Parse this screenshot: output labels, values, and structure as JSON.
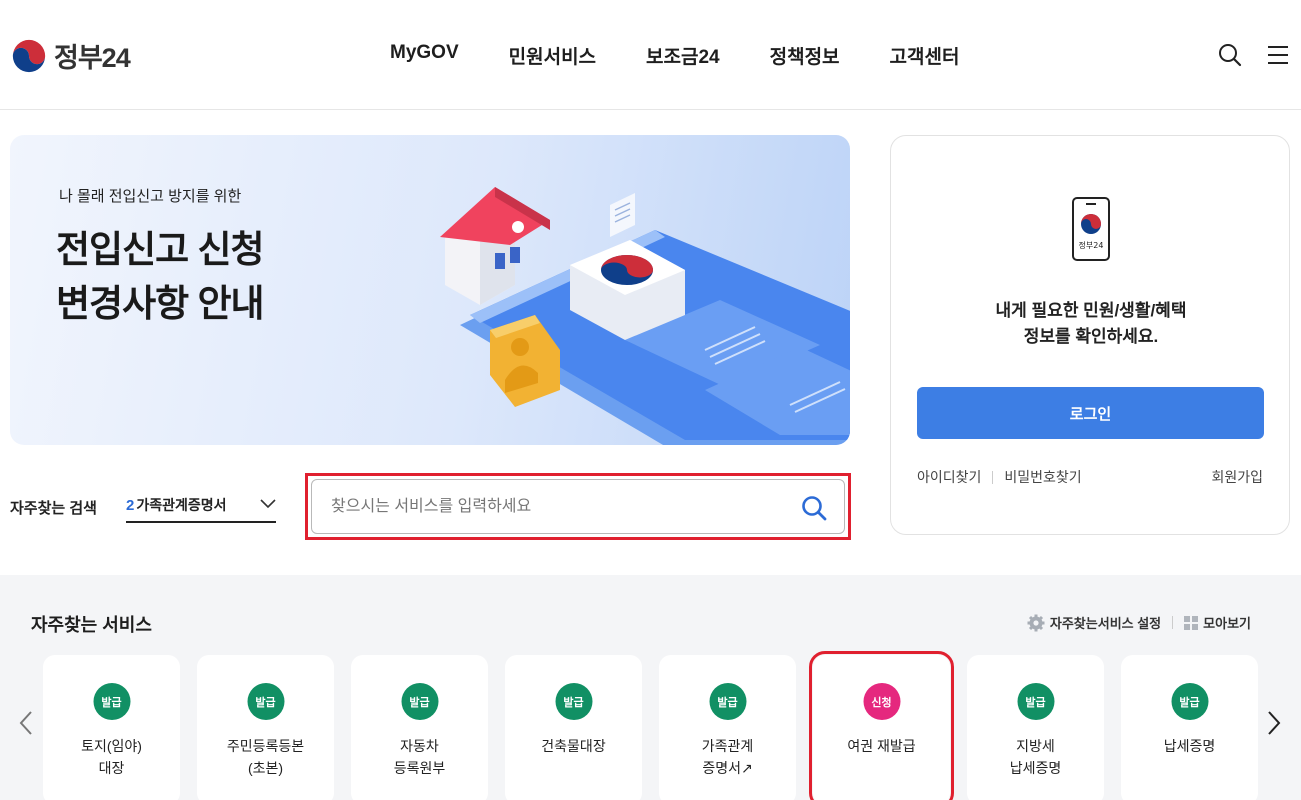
{
  "header": {
    "logo_text": "정부24",
    "nav": [
      "MyGOV",
      "민원서비스",
      "보조금24",
      "정책정보",
      "고객센터"
    ],
    "icons": [
      "search-icon",
      "menu-icon"
    ]
  },
  "banner": {
    "subtitle": "나 몰래 전입신고 방지를 위한",
    "title_line1": "전입신고 신청",
    "title_line2": "변경사항 안내"
  },
  "login": {
    "phone_label": "정부24",
    "message_line1": "내게 필요한 민원/생활/혜택",
    "message_line2": "정보를 확인하세요.",
    "button": "로그인",
    "find_id": "아이디찾기",
    "find_pw": "비밀번호찾기",
    "join": "회원가입"
  },
  "search": {
    "label": "자주찾는 검색",
    "keyword_rank": "2",
    "keyword_text": "가족관계증명서",
    "placeholder": "찾으시는 서비스를 입력하세요"
  },
  "services": {
    "title": "자주찾는 서비스",
    "settings_label": "자주찾는서비스 설정",
    "view_all_label": "모아보기",
    "cards": [
      {
        "badge": "발급",
        "label": "토지(임야)\n대장"
      },
      {
        "badge": "발급",
        "label": "주민등록등본\n(초본)"
      },
      {
        "badge": "발급",
        "label": "자동차\n등록원부"
      },
      {
        "badge": "발급",
        "label": "건축물대장"
      },
      {
        "badge": "발급",
        "label": "가족관계\n증명서↗"
      },
      {
        "badge": "신청",
        "label": "여권 재발급"
      },
      {
        "badge": "발급",
        "label": "지방세\n납세증명"
      },
      {
        "badge": "발급",
        "label": "납세증명"
      }
    ]
  },
  "colors": {
    "primary_button": "#3d7ee4",
    "badge_issue": "#119064",
    "badge_apply": "#e5287e",
    "highlight": "#e0202f"
  }
}
